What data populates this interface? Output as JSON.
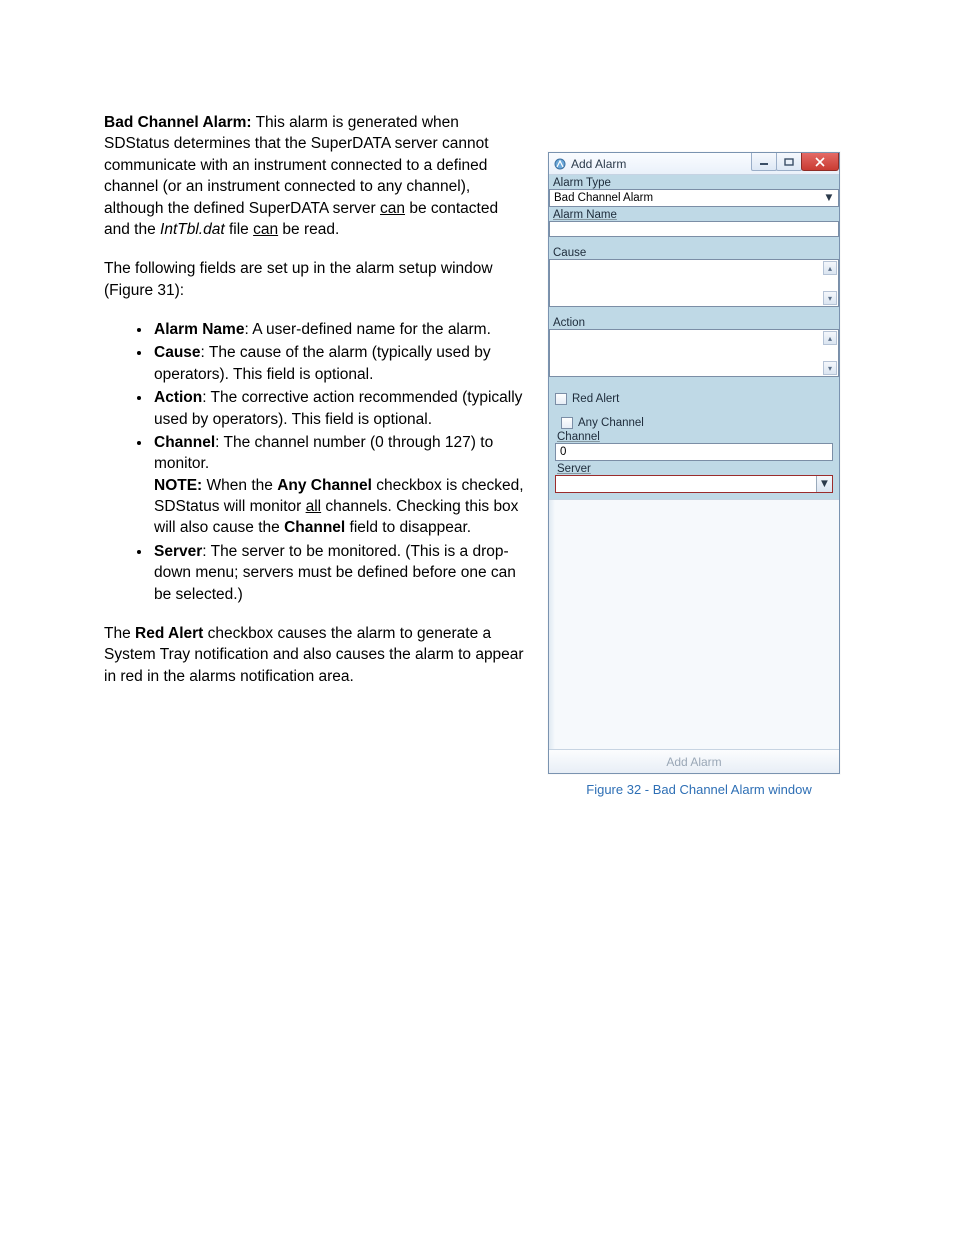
{
  "text": {
    "heading": "Bad Channel Alarm:",
    "p1_after_heading": " This alarm is generated when SDStatus determines that the SuperDATA server cannot communicate with an instrument connected to a defined channel (or an instrument connected to any channel), although the defined SuperDATA server ",
    "can1": "can",
    "p1_mid": " be contacted and the ",
    "inttbl": "IntTbl.dat",
    "p1_mid2": "  file ",
    "can2": "can",
    "p1_end": " be read.",
    "p2": "The following fields are set up in the alarm setup window (Figure 31):",
    "b1_label": "Alarm Name",
    "b1_rest": ": A user-defined name for the alarm.",
    "b2_label": "Cause",
    "b2_rest": ": The cause of the alarm (typically used by operators). This field is optional.",
    "b3_label": "Action",
    "b3_rest": ": The corrective action recommended (typically used by operators). This field is optional.",
    "b4_label": "Channel",
    "b4_rest": ": The channel number (0 through 127) to monitor.",
    "b4_note_label": "NOTE:",
    "b4_note_pre": " When the ",
    "b4_anych": "Any Channel",
    "b4_note_mid": " checkbox is checked, SDStatus will monitor ",
    "b4_all": "all",
    "b4_note_mid2": " channels. Checking this box will also cause the ",
    "b4_channel2": "Channel",
    "b4_note_end": " field to disappear.",
    "b5_label": "Server",
    "b5_rest": ": The server to be monitored. (This is a drop-down menu; servers must be defined before one can be selected.)",
    "p3_pre": "The ",
    "p3_red": "Red Alert",
    "p3_rest": " checkbox causes the alarm to generate a System Tray notification and also causes the alarm to appear in red in the alarms notification area."
  },
  "window": {
    "title": "Add Alarm",
    "labels": {
      "alarm_type": "Alarm Type",
      "alarm_name": "Alarm Name",
      "cause": "Cause",
      "action": "Action",
      "red_alert": "Red Alert",
      "any_channel": "Any Channel",
      "channel": "Channel",
      "server": "Server"
    },
    "values": {
      "alarm_type_selected": "Bad Channel Alarm",
      "channel": "0"
    },
    "button": "Add Alarm",
    "caption": "Figure 32 - Bad Channel Alarm window"
  }
}
